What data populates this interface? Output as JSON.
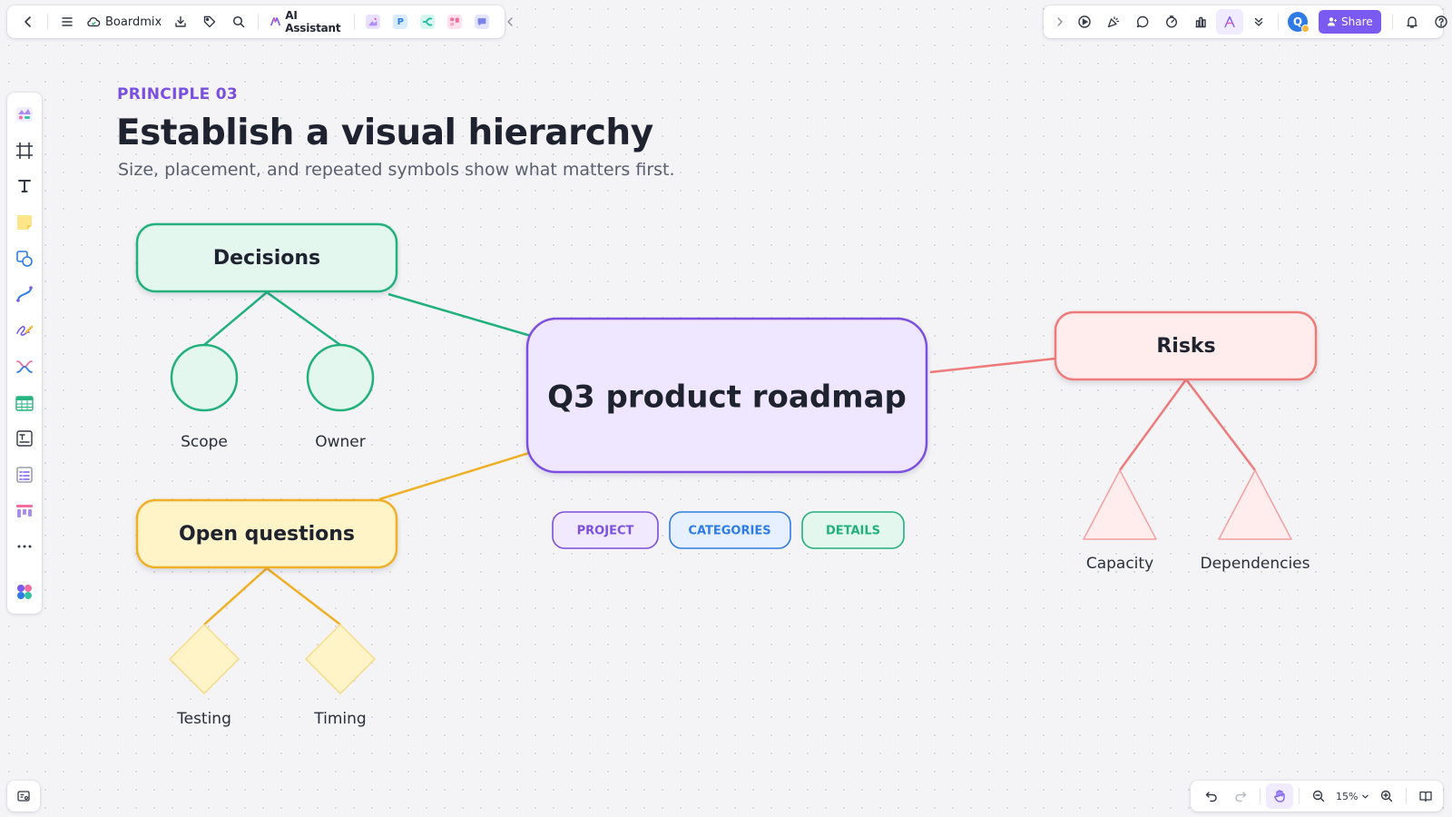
{
  "app": {
    "brand": "Boardmix",
    "ai_assistant": "AI Assistant",
    "share_label": "Share",
    "avatar_initial": "Q",
    "zoom_level": "15%",
    "accent_color": "#7a5af0"
  },
  "heading": {
    "eyebrow": "PRINCIPLE 03",
    "title": "Establish a visual hierarchy",
    "subtitle": "Size, placement, and repeated symbols show what matters first."
  },
  "diagram": {
    "center": {
      "label": "Q3 product roadmap",
      "color": "#7b4fe0",
      "fill": "#efe7ff"
    },
    "decisions": {
      "label": "Decisions",
      "color": "#22b07d",
      "fill": "#e3f7ee",
      "children": [
        "Scope",
        "Owner"
      ]
    },
    "open_questions": {
      "label": "Open questions",
      "color": "#efb025",
      "fill": "#fff3c8",
      "children": [
        "Testing",
        "Timing"
      ]
    },
    "risks": {
      "label": "Risks",
      "color": "#ee7a7a",
      "fill": "#ffecec",
      "children": [
        "Capacity",
        "Dependencies"
      ]
    },
    "tags": [
      {
        "label": "PROJECT",
        "color": "#7b4fe0",
        "fill": "#f1eaff"
      },
      {
        "label": "CATEGORIES",
        "color": "#2f7be6",
        "fill": "#e6f0ff"
      },
      {
        "label": "DETAILS",
        "color": "#22b07d",
        "fill": "#e3f7ee"
      }
    ]
  },
  "icons": {
    "top_left": [
      "back-icon",
      "menu-icon",
      "cloud-icon",
      "download-icon",
      "tag-icon",
      "search-icon",
      "ai-icon",
      "collapse-icon"
    ],
    "top_right": [
      "expand-icon",
      "play-icon",
      "party-icon",
      "comment-icon",
      "timer-icon",
      "chart-icon",
      "flag-icon",
      "more-down-icon",
      "bell-icon",
      "help-icon"
    ],
    "left_toolbar": [
      "templates-icon",
      "frame-icon",
      "text-icon",
      "sticky-note-icon",
      "shape-icon",
      "connector-icon",
      "pen-icon",
      "mindmap-icon",
      "table-icon",
      "text-block-icon",
      "list-icon",
      "kanban-icon",
      "more-icon",
      "apps-icon"
    ],
    "bottom": [
      "minimap-icon",
      "undo-icon",
      "redo-icon",
      "hand-icon",
      "zoom-out-icon",
      "zoom-in-icon",
      "book-icon"
    ]
  }
}
